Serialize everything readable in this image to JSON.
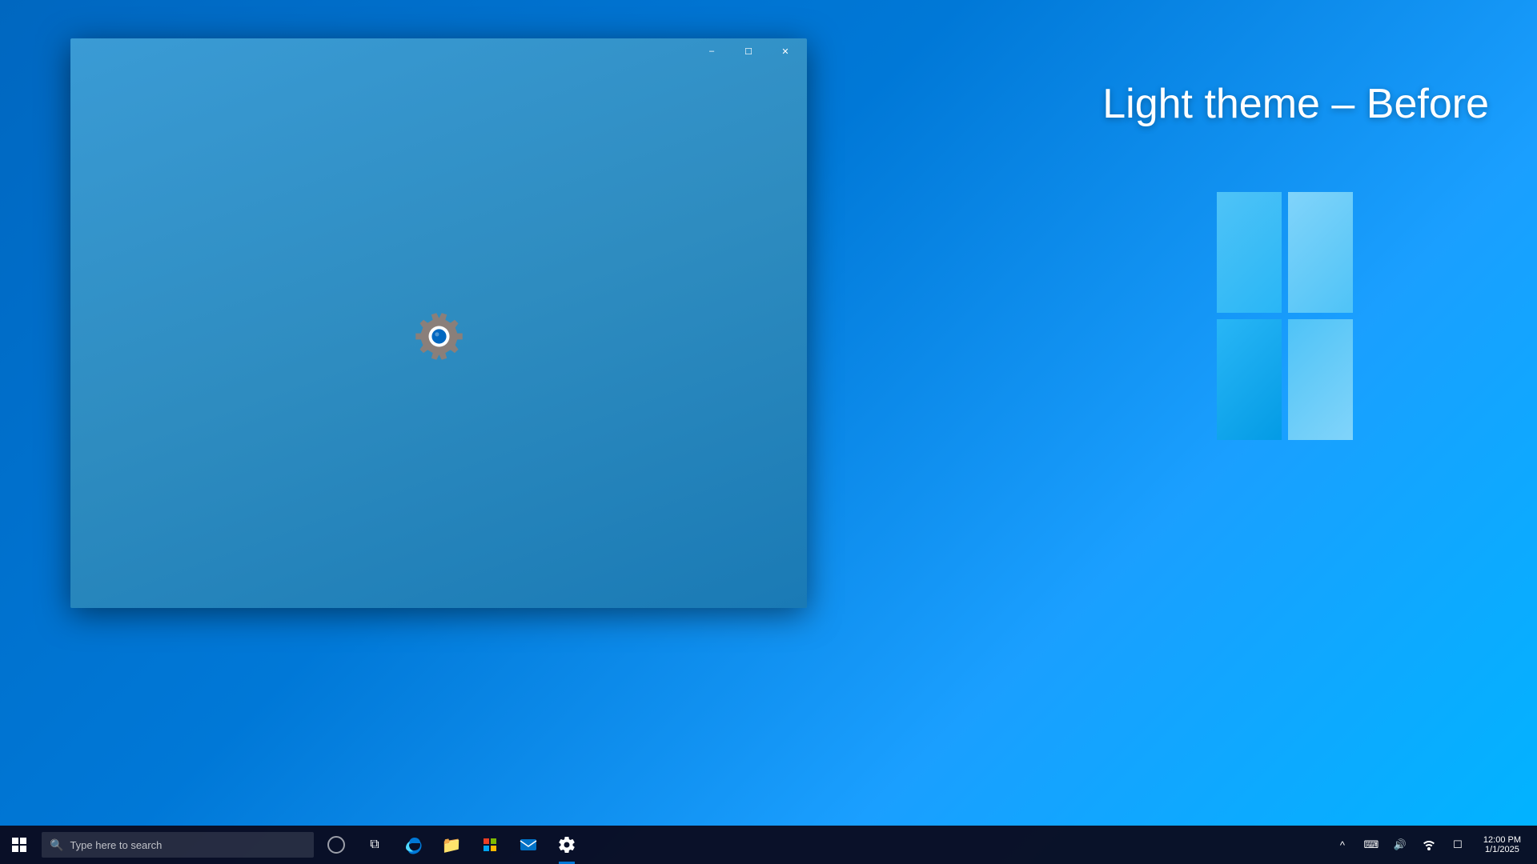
{
  "desktop": {
    "background_color_start": "#0067c0",
    "background_color_end": "#00b4ff"
  },
  "annotation": {
    "text": "Light theme – Before"
  },
  "settings_window": {
    "title": "Settings",
    "loading": true,
    "titlebar": {
      "minimize_label": "–",
      "maximize_label": "☐",
      "close_label": "✕"
    }
  },
  "taskbar": {
    "search_placeholder": "Type here to search",
    "apps": [
      {
        "name": "Cortana",
        "icon": "○"
      },
      {
        "name": "Task View",
        "icon": "⧉"
      },
      {
        "name": "Microsoft Edge",
        "icon": "e"
      },
      {
        "name": "File Explorer",
        "icon": "📁"
      },
      {
        "name": "Office",
        "icon": "O"
      },
      {
        "name": "Mail",
        "icon": "✉"
      },
      {
        "name": "Settings",
        "icon": "⚙",
        "active": true
      }
    ],
    "tray": {
      "chevron_label": "^",
      "keyboard_label": "⌨",
      "volume_label": "🔊",
      "network_label": "🌐",
      "action_center_label": "☐"
    },
    "clock": {
      "time": "12:00 PM",
      "date": "1/1/2025"
    }
  }
}
